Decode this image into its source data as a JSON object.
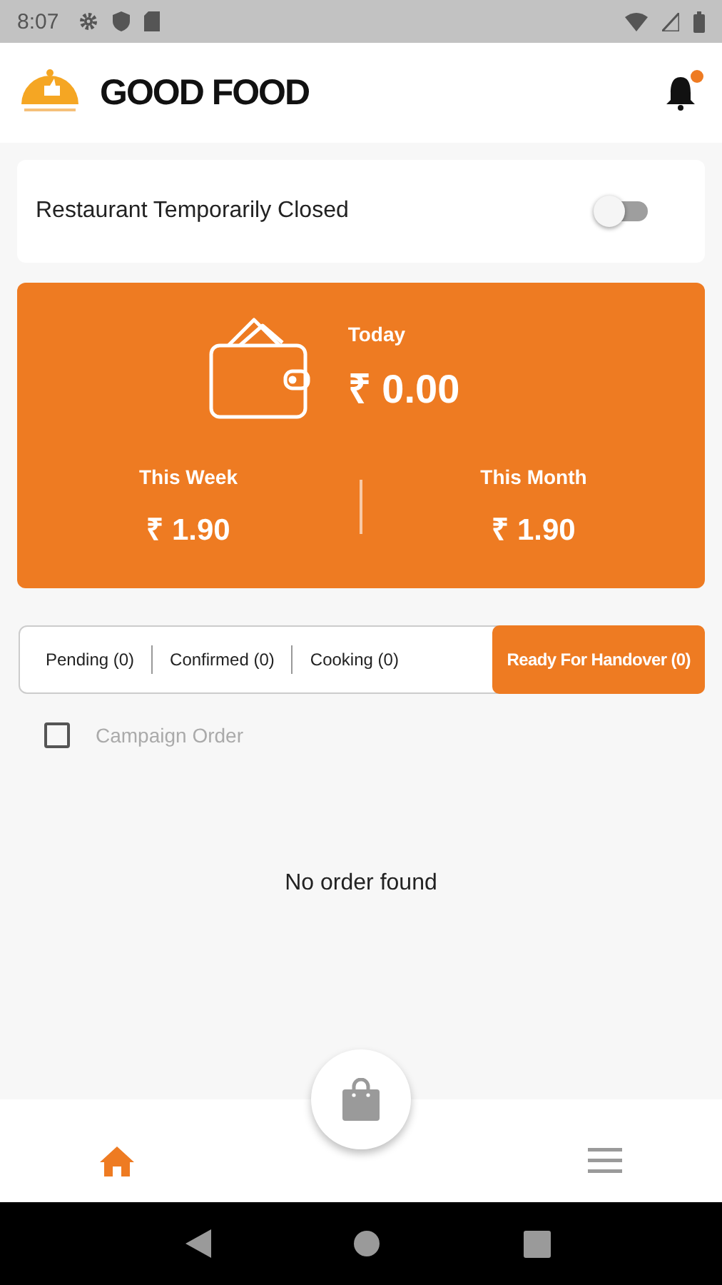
{
  "status_bar": {
    "time": "8:07"
  },
  "header": {
    "title": "GOOD FOOD",
    "notification_dot": true
  },
  "closed_toggle": {
    "label": "Restaurant Temporarily Closed",
    "on": false
  },
  "earnings": {
    "today_label": "Today",
    "today_value": "₹ 0.00",
    "week_label": "This Week",
    "week_value": "₹ 1.90",
    "month_label": "This Month",
    "month_value": "₹ 1.90"
  },
  "tabs": [
    {
      "label": "Pending (0)",
      "selected": false
    },
    {
      "label": "Confirmed (0)",
      "selected": false
    },
    {
      "label": "Cooking (0)",
      "selected": false
    },
    {
      "label": "Ready For Handover (0)",
      "selected": true
    }
  ],
  "campaign_filter": {
    "label": "Campaign Order",
    "checked": false
  },
  "empty_message": "No order found",
  "bottom_nav": [
    {
      "kind": "home",
      "selected": true
    },
    {
      "kind": "menu",
      "selected": false
    }
  ]
}
